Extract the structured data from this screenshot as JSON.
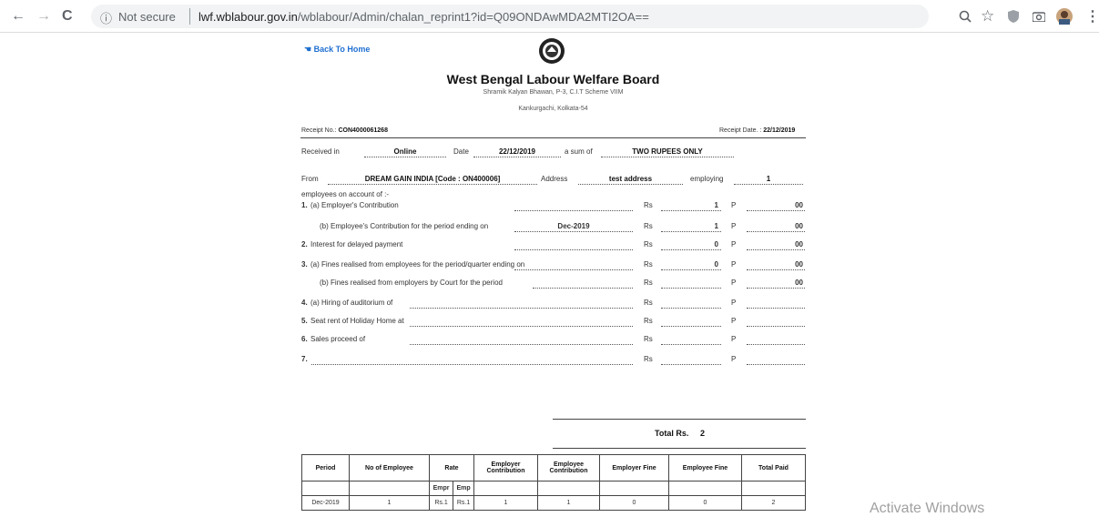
{
  "browser": {
    "back_icon": "←",
    "forward_icon": "→",
    "reload_icon": "C",
    "info_icon": "ⓘ",
    "not_secure": "Not secure",
    "url_domain": "lwf.wblabour.gov.in",
    "url_path": "/wblabour/Admin/chalan_reprint1?id=Q09ONDAwMDA2MTI2OA=="
  },
  "header": {
    "back_link": "Back To Home",
    "title": "West Bengal Labour Welfare Board",
    "address1": "Shramik Kalyan Bhawan, P-3, C.I.T Scheme VIIM",
    "address2": "Kankurgachi, Kolkata-54"
  },
  "receipt": {
    "no_label": "Receipt No.:",
    "no_value": "CON4000061268",
    "date_label": "Receipt Date. :",
    "date_value": "22/12/2019"
  },
  "line1": {
    "received_in": "Received in",
    "mode": "Online",
    "date_label": "Date",
    "date": "22/12/2019",
    "sum_label": "a sum of",
    "sum": "TWO RUPEES ONLY"
  },
  "line2": {
    "from": "From",
    "from_value": "DREAM GAIN INDIA [Code : ON400006]",
    "address_label": "Address",
    "address_value": "test address",
    "employing": "employing",
    "employing_value": "1",
    "employees_on_account": "employees on account of :-"
  },
  "items": [
    {
      "num": "1.",
      "label": "(a) Employer's Contribution",
      "mid": "",
      "rs_label": "Rs",
      "rs": "1",
      "p_label": "P",
      "p": "00"
    },
    {
      "num": "",
      "label": "(b) Employee's Contribution for the period ending on",
      "mid": "Dec-2019",
      "rs_label": "Rs",
      "rs": "1",
      "p_label": "P",
      "p": "00"
    },
    {
      "num": "2.",
      "label": "Interest for delayed payment",
      "mid": "",
      "rs_label": "Rs",
      "rs": "0",
      "p_label": "P",
      "p": "00"
    },
    {
      "num": "3.",
      "label": "(a) Fines realised from employees for the period/quarter ending on",
      "mid": "",
      "rs_label": "Rs",
      "rs": "0",
      "p_label": "P",
      "p": "00"
    },
    {
      "num": "",
      "label": "(b) Fines realised from employers by Court for the period",
      "mid": "",
      "rs_label": "Rs",
      "rs": "",
      "p_label": "P",
      "p": "00"
    },
    {
      "num": "4.",
      "label": "(a) Hiring of auditorium of",
      "mid": "",
      "rs_label": "Rs",
      "rs": "",
      "p_label": "P",
      "p": ""
    },
    {
      "num": "5.",
      "label": "Seat rent of Holiday Home at",
      "mid": "",
      "rs_label": "Rs",
      "rs": "",
      "p_label": "P",
      "p": ""
    },
    {
      "num": "6.",
      "label": "Sales proceed of",
      "mid": "",
      "rs_label": "Rs",
      "rs": "",
      "p_label": "P",
      "p": ""
    },
    {
      "num": "7.",
      "label": "",
      "mid": "",
      "rs_label": "Rs",
      "rs": "",
      "p_label": "P",
      "p": ""
    }
  ],
  "total": {
    "label": "Total Rs.",
    "value": "2"
  },
  "table": {
    "headers": [
      "Period",
      "No of Employee",
      "Rate",
      "Employer Contribution",
      "Employee Contribution",
      "Employer Fine",
      "Employee Fine",
      "Total Paid"
    ],
    "rate_sub": [
      "Empr",
      "Emp"
    ],
    "row": [
      "Dec-2019",
      "1",
      "Rs.1",
      "Rs.1",
      "1",
      "1",
      "0",
      "0",
      "2"
    ]
  },
  "overlay": {
    "activate": "Activate Windows"
  }
}
